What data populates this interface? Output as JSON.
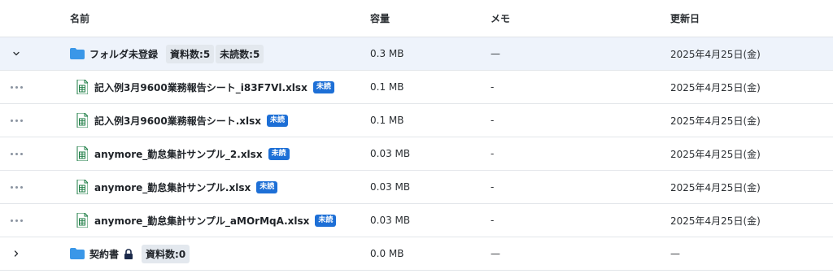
{
  "header": {
    "name": "名前",
    "size": "容量",
    "memo": "メモ",
    "updated": "更新日"
  },
  "icons": {
    "folder_color": "#3a97e8",
    "excel_color": "#1e7d45",
    "badge_color": "#1d6fd6",
    "lock_color": "#1b2a4a"
  },
  "folders": [
    {
      "name": "フォルダ未登録",
      "doc_count": "資料数:5",
      "unread_count": "未読数:5",
      "size": "0.3 MB",
      "memo": "—",
      "updated": "2025年4月25日(金)",
      "expanded": true,
      "files": [
        {
          "name": "記入例3月9600業務報告シート_i83F7Vl.xlsx",
          "badge": "未読",
          "size": "0.1 MB",
          "memo": "-",
          "updated": "2025年4月25日(金)"
        },
        {
          "name": "記入例3月9600業務報告シート.xlsx",
          "badge": "未読",
          "size": "0.1 MB",
          "memo": "-",
          "updated": "2025年4月25日(金)"
        },
        {
          "name": "anymore_勤怠集計サンプル_2.xlsx",
          "badge": "未読",
          "size": "0.03 MB",
          "memo": "-",
          "updated": "2025年4月25日(金)"
        },
        {
          "name": "anymore_勤怠集計サンプル.xlsx",
          "badge": "未読",
          "size": "0.03 MB",
          "memo": "-",
          "updated": "2025年4月25日(金)"
        },
        {
          "name": "anymore_勤怠集計サンプル_aMOrMqA.xlsx",
          "badge": "未読",
          "size": "0.03 MB",
          "memo": "-",
          "updated": "2025年4月25日(金)"
        }
      ]
    },
    {
      "name": "契約書",
      "locked": true,
      "doc_count": "資料数:0",
      "size": "0.0 MB",
      "memo": "—",
      "updated": "—",
      "expanded": false
    }
  ]
}
